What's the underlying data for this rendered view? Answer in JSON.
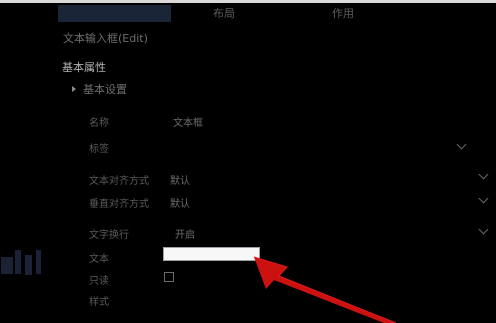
{
  "tabs": {
    "layout": "布局",
    "scope": "作用"
  },
  "element_title": "文本输入框(Edit)",
  "section_title": "基本属性",
  "group_title": "基本设置",
  "properties": {
    "name_label": "名称",
    "name_value": "文本框",
    "row2_label": "标签",
    "row3_label": "文本对齐方式",
    "row3_value": "默认",
    "row4_label": "垂直对齐方式",
    "row4_value": "默认",
    "row5_label": "文字换行",
    "row5_value": "开启",
    "text_label": "文本",
    "row7_label": "只读",
    "row8_label": "样式"
  },
  "colors": {
    "background": "#000000",
    "arrow": "#cc1111",
    "input_fill": "#f7f7f7"
  },
  "icons": [
    "chevron-down-icon",
    "expand-triangle-icon",
    "red-arrow-annotation"
  ]
}
